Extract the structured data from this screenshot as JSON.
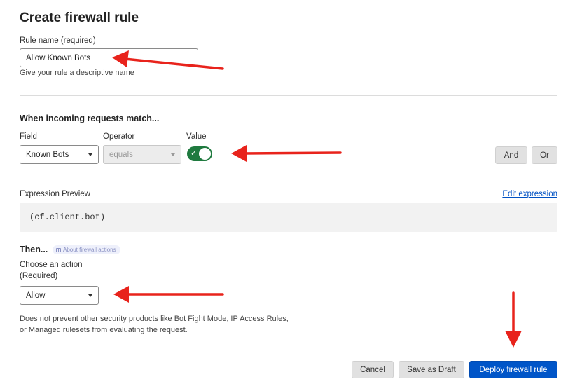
{
  "page": {
    "title": "Create firewall rule"
  },
  "rule_name": {
    "label": "Rule name (required)",
    "value": "Allow Known Bots",
    "help": "Give your rule a descriptive name"
  },
  "match": {
    "heading": "When incoming requests match...",
    "field_label": "Field",
    "field_value": "Known Bots",
    "operator_label": "Operator",
    "operator_value": "equals",
    "value_label": "Value",
    "value_toggle": true,
    "toggle_check": "✓",
    "and_label": "And",
    "or_label": "Or"
  },
  "expression": {
    "label": "Expression Preview",
    "edit_link": "Edit expression",
    "code": "(cf.client.bot)"
  },
  "then": {
    "heading": "Then...",
    "about_pill": "About firewall actions",
    "action_label_line1": "Choose an action",
    "action_label_line2": "(Required)",
    "action_value": "Allow",
    "note_line1": "Does not prevent other security products like Bot Fight Mode, IP Access Rules,",
    "note_line2": "or Managed rulesets from evaluating the request."
  },
  "footer": {
    "cancel": "Cancel",
    "save_draft": "Save as Draft",
    "deploy": "Deploy firewall rule"
  },
  "colors": {
    "primary": "#0055c8",
    "toggle_on": "#1f7a3f",
    "annotation_arrow": "#e8231c"
  }
}
